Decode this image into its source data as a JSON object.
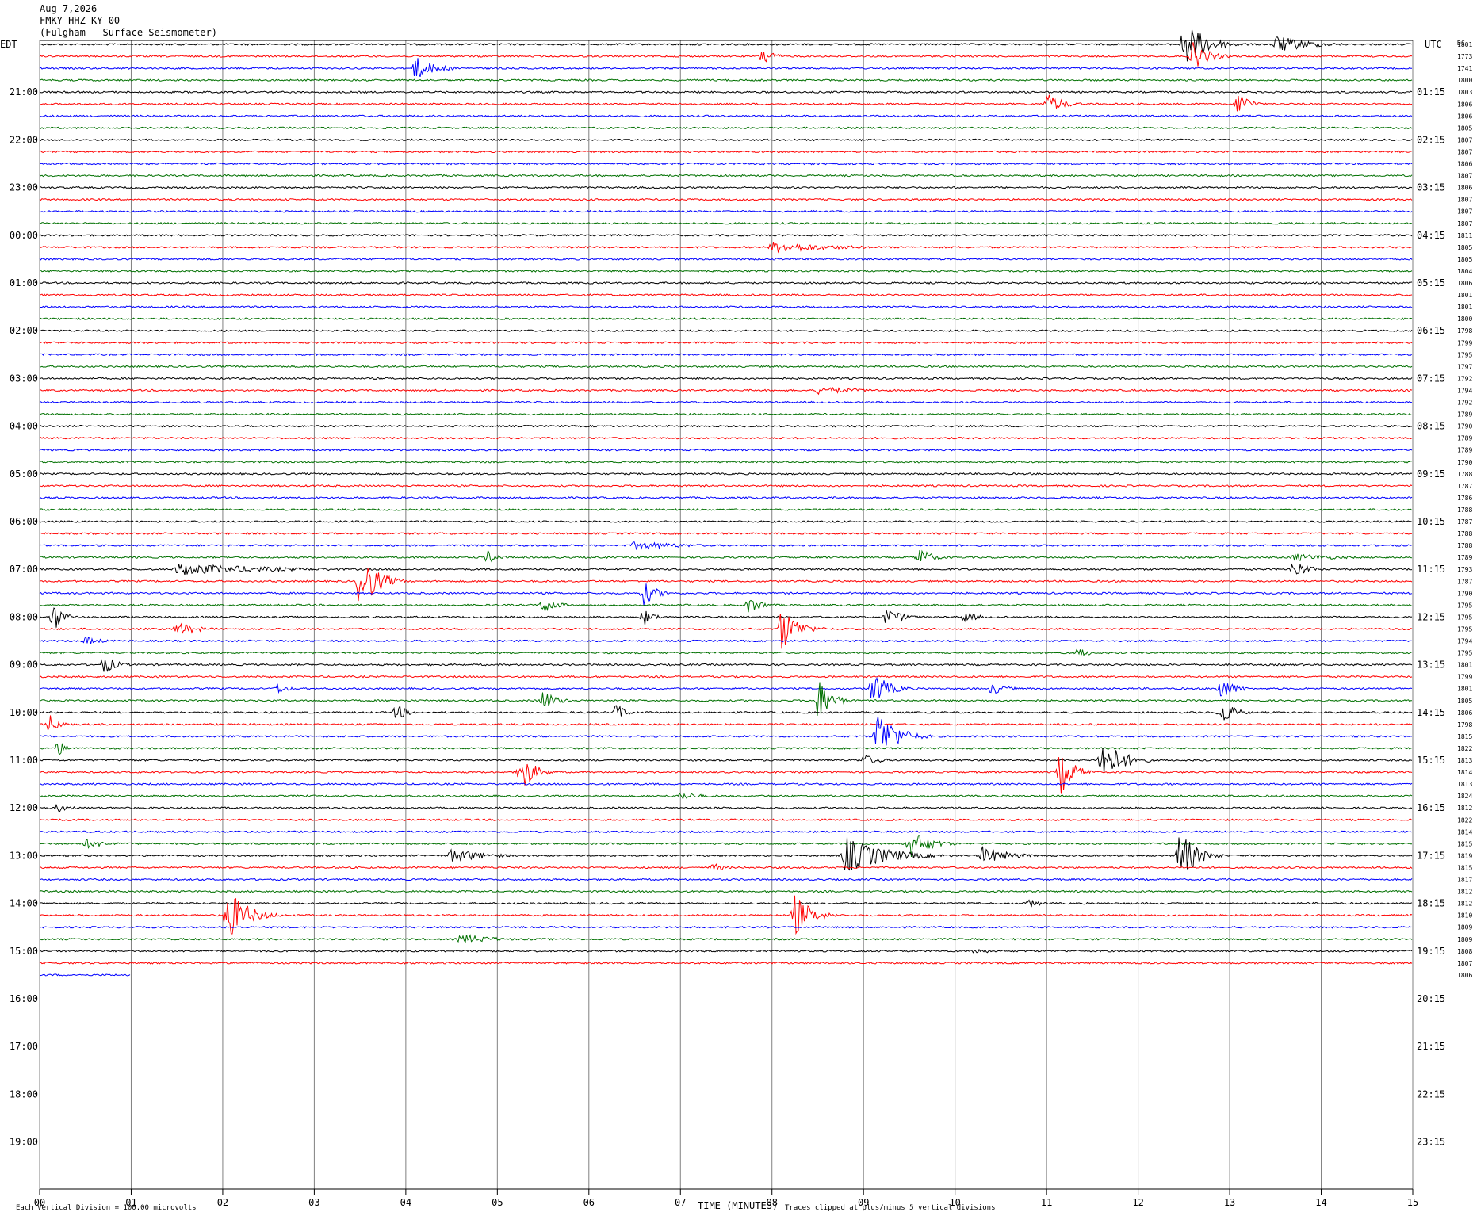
{
  "header": {
    "date": "Aug 7,2026",
    "station": "FMKY HHZ KY 00",
    "location": "(Fulgham - Surface Seismometer)"
  },
  "labels": {
    "left_zone": "EDT",
    "right_zone": "UTC",
    "dc_header": "DC",
    "xlabel": "TIME (MINUTES)",
    "scale_note": "Each Vertical Division =  100.00 microvolts",
    "clip_note": "Traces clipped at plus/minus 5 vertical divisions"
  },
  "colors": {
    "trace_cycle": [
      "#000000",
      "#ff0000",
      "#0000ff",
      "#007000"
    ],
    "gridline": "#808080",
    "text": "#000000"
  },
  "chart_data": {
    "type": "helicorder",
    "minutes_per_line": 15,
    "x_ticks": [
      "00",
      "01",
      "02",
      "03",
      "04",
      "05",
      "06",
      "07",
      "08",
      "09",
      "10",
      "11",
      "12",
      "13",
      "14",
      "15"
    ],
    "xlim": [
      0,
      15
    ],
    "left_hour_labels": [
      "21:00",
      "22:00",
      "23:00",
      "00:00",
      "01:00",
      "02:00",
      "03:00",
      "04:00",
      "05:00",
      "06:00",
      "07:00",
      "08:00",
      "09:00",
      "10:00",
      "11:00",
      "12:00",
      "13:00",
      "14:00",
      "15:00",
      "16:00",
      "17:00",
      "18:00",
      "19:00"
    ],
    "right_hour_labels": [
      "01:15",
      "02:15",
      "03:15",
      "04:15",
      "05:15",
      "06:15",
      "07:15",
      "08:15",
      "09:15",
      "10:15",
      "11:15",
      "12:15",
      "13:15",
      "14:15",
      "15:15",
      "16:15",
      "17:15",
      "18:15",
      "19:15",
      "20:15",
      "21:15",
      "22:15",
      "23:15"
    ],
    "dc_offsets": [
      "1801",
      "1773",
      "1741",
      "1800",
      "1803",
      "1806",
      "1806",
      "1805",
      "1807",
      "1807",
      "1806",
      "1807",
      "1806",
      "1807",
      "1807",
      "1807",
      "1811",
      "1805",
      "1805",
      "1804",
      "1806",
      "1801",
      "1801",
      "1800",
      "1798",
      "1799",
      "1795",
      "1797",
      "1792",
      "1794",
      "1792",
      "1789",
      "1790",
      "1789",
      "1789",
      "1790",
      "1788",
      "1787",
      "1786",
      "1788",
      "1787",
      "1788",
      "1788",
      "1789",
      "1793",
      "1787",
      "1790",
      "1795",
      "1795",
      "1795",
      "1794",
      "1795",
      "1801",
      "1799",
      "1801",
      "1805",
      "1806",
      "1798",
      "1815",
      "1822",
      "1813",
      "1814",
      "1813",
      "1824",
      "1812",
      "1822",
      "1814",
      "1815",
      "1819",
      "1815",
      "1817",
      "1812",
      "1812",
      "1810",
      "1809",
      "1809",
      "1808",
      "1807",
      "1806"
    ],
    "num_traces": 79,
    "last_trace_end_minute": 1.0,
    "events": [
      {
        "trace": 0,
        "minute": 12.5,
        "amp": 30,
        "dur": 0.7
      },
      {
        "trace": 0,
        "minute": 13.5,
        "amp": 12,
        "dur": 1.0
      },
      {
        "trace": 1,
        "minute": 7.9,
        "amp": 14,
        "dur": 0.3
      },
      {
        "trace": 1,
        "minute": 12.6,
        "amp": 18,
        "dur": 0.5
      },
      {
        "trace": 2,
        "minute": 4.1,
        "amp": 16,
        "dur": 0.6
      },
      {
        "trace": 5,
        "minute": 11.0,
        "amp": 14,
        "dur": 0.5
      },
      {
        "trace": 5,
        "minute": 13.1,
        "amp": 20,
        "dur": 0.3
      },
      {
        "trace": 17,
        "minute": 8.0,
        "amp": 7,
        "dur": 2.0
      },
      {
        "trace": 29,
        "minute": 8.5,
        "amp": 5,
        "dur": 1.5
      },
      {
        "trace": 42,
        "minute": 6.5,
        "amp": 6,
        "dur": 1.5
      },
      {
        "trace": 43,
        "minute": 4.9,
        "amp": 10,
        "dur": 0.3
      },
      {
        "trace": 43,
        "minute": 9.6,
        "amp": 14,
        "dur": 0.4
      },
      {
        "trace": 43,
        "minute": 13.7,
        "amp": 5,
        "dur": 1.5
      },
      {
        "trace": 44,
        "minute": 1.5,
        "amp": 8,
        "dur": 3.0
      },
      {
        "trace": 44,
        "minute": 13.7,
        "amp": 14,
        "dur": 0.4
      },
      {
        "trace": 45,
        "minute": 3.5,
        "amp": 40,
        "dur": 0.5
      },
      {
        "trace": 46,
        "minute": 6.6,
        "amp": 16,
        "dur": 0.4
      },
      {
        "trace": 47,
        "minute": 5.5,
        "amp": 12,
        "dur": 0.4
      },
      {
        "trace": 47,
        "minute": 7.75,
        "amp": 12,
        "dur": 0.4
      },
      {
        "trace": 48,
        "minute": 0.15,
        "amp": 20,
        "dur": 0.3
      },
      {
        "trace": 48,
        "minute": 6.6,
        "amp": 12,
        "dur": 0.3
      },
      {
        "trace": 48,
        "minute": 9.25,
        "amp": 12,
        "dur": 0.5
      },
      {
        "trace": 48,
        "minute": 10.1,
        "amp": 8,
        "dur": 0.4
      },
      {
        "trace": 49,
        "minute": 1.5,
        "amp": 10,
        "dur": 0.6
      },
      {
        "trace": 49,
        "minute": 8.1,
        "amp": 30,
        "dur": 0.5
      },
      {
        "trace": 50,
        "minute": 0.5,
        "amp": 6,
        "dur": 0.5
      },
      {
        "trace": 51,
        "minute": 11.35,
        "amp": 8,
        "dur": 0.3
      },
      {
        "trace": 52,
        "minute": 0.7,
        "amp": 12,
        "dur": 0.4
      },
      {
        "trace": 54,
        "minute": 2.6,
        "amp": 8,
        "dur": 0.3
      },
      {
        "trace": 54,
        "minute": 9.1,
        "amp": 22,
        "dur": 0.5
      },
      {
        "trace": 54,
        "minute": 10.4,
        "amp": 8,
        "dur": 0.5
      },
      {
        "trace": 54,
        "minute": 12.9,
        "amp": 16,
        "dur": 0.4
      },
      {
        "trace": 55,
        "minute": 5.5,
        "amp": 14,
        "dur": 0.4
      },
      {
        "trace": 55,
        "minute": 8.5,
        "amp": 30,
        "dur": 0.4
      },
      {
        "trace": 56,
        "minute": 3.9,
        "amp": 12,
        "dur": 0.3
      },
      {
        "trace": 56,
        "minute": 6.3,
        "amp": 12,
        "dur": 0.3
      },
      {
        "trace": 56,
        "minute": 12.9,
        "amp": 18,
        "dur": 0.4
      },
      {
        "trace": 57,
        "minute": 0.1,
        "amp": 14,
        "dur": 0.3
      },
      {
        "trace": 58,
        "minute": 9.15,
        "amp": 35,
        "dur": 0.6
      },
      {
        "trace": 59,
        "minute": 0.2,
        "amp": 10,
        "dur": 0.3
      },
      {
        "trace": 60,
        "minute": 11.6,
        "amp": 30,
        "dur": 0.6
      },
      {
        "trace": 60,
        "minute": 9.0,
        "amp": 8,
        "dur": 0.5
      },
      {
        "trace": 61,
        "minute": 5.25,
        "amp": 28,
        "dur": 0.4
      },
      {
        "trace": 61,
        "minute": 11.15,
        "amp": 30,
        "dur": 0.4
      },
      {
        "trace": 63,
        "minute": 7.0,
        "amp": 6,
        "dur": 0.6
      },
      {
        "trace": 64,
        "minute": 0.2,
        "amp": 6,
        "dur": 0.4
      },
      {
        "trace": 67,
        "minute": 9.5,
        "amp": 20,
        "dur": 0.6
      },
      {
        "trace": 67,
        "minute": 0.5,
        "amp": 6,
        "dur": 0.8
      },
      {
        "trace": 68,
        "minute": 8.8,
        "amp": 25,
        "dur": 1.2
      },
      {
        "trace": 68,
        "minute": 10.3,
        "amp": 12,
        "dur": 0.8
      },
      {
        "trace": 68,
        "minute": 12.45,
        "amp": 35,
        "dur": 0.5
      },
      {
        "trace": 68,
        "minute": 4.5,
        "amp": 10,
        "dur": 1.0
      },
      {
        "trace": 69,
        "minute": 7.35,
        "amp": 6,
        "dur": 0.4
      },
      {
        "trace": 72,
        "minute": 10.8,
        "amp": 6,
        "dur": 0.4
      },
      {
        "trace": 73,
        "minute": 2.05,
        "amp": 35,
        "dur": 0.6
      },
      {
        "trace": 73,
        "minute": 8.25,
        "amp": 28,
        "dur": 0.5
      },
      {
        "trace": 75,
        "minute": 4.6,
        "amp": 7,
        "dur": 1.0
      },
      {
        "trace": 76,
        "minute": 10.2,
        "amp": 4,
        "dur": 0.6
      }
    ]
  }
}
